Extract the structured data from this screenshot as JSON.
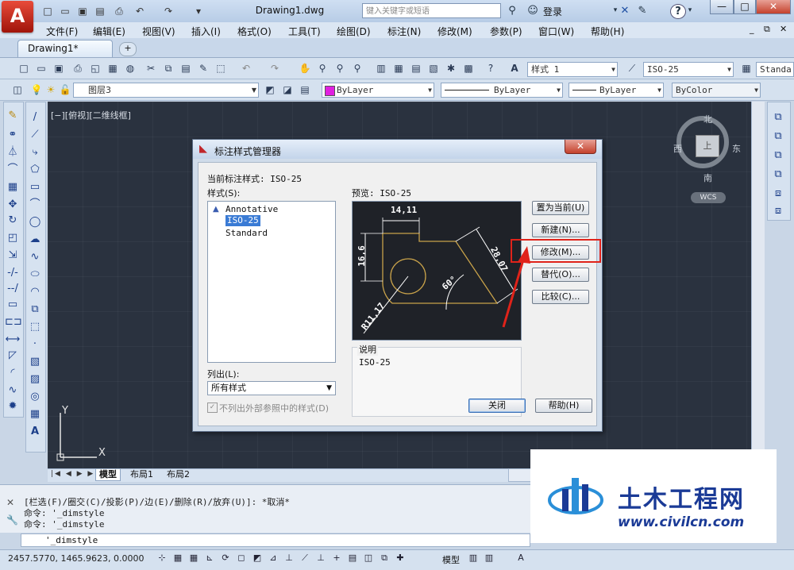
{
  "titlebar": {
    "doc_title": "Drawing1.dwg",
    "search_placeholder": "键入关键字或短语",
    "login_label": "登录",
    "help_label": "?"
  },
  "menubar": {
    "items": [
      "文件(F)",
      "编辑(E)",
      "视图(V)",
      "插入(I)",
      "格式(O)",
      "工具(T)",
      "绘图(D)",
      "标注(N)",
      "修改(M)",
      "参数(P)",
      "窗口(W)",
      "帮助(H)"
    ]
  },
  "tabs": {
    "active_label": "Drawing1*"
  },
  "toolbars": {
    "text_style": "样式 1",
    "dim_style": "ISO-25",
    "table_style": "Standa",
    "layer": "图层3",
    "color": "ByLayer",
    "linetype": "ByLayer",
    "lineweight": "ByLayer",
    "plotstyle": "ByColor"
  },
  "viewport": {
    "label": "[−][俯视][二维线框]",
    "compass_north": "北",
    "compass_south": "南",
    "compass_east": "东",
    "compass_west": "西",
    "compass_center": "上",
    "wcs_label": "WCS",
    "ucs_x": "X",
    "ucs_y": "Y"
  },
  "layout_tabs": [
    "模型",
    "布局1",
    "布局2"
  ],
  "command": {
    "lines": [
      "[栏选(F)/圈交(C)/投影(P)/边(E)/删除(R)/放弃(U)]: *取消*",
      "命令: '_dimstyle",
      "命令: '_dimstyle"
    ],
    "input": "'_dimstyle"
  },
  "statusbar": {
    "coords": "2457.5770, 1465.9623, 0.0000",
    "model_label": "模型"
  },
  "dialog": {
    "title": "标注样式管理器",
    "current_style_label": "当前标注样式: ISO-25",
    "styles_label": "样式(S):",
    "styles": [
      "Annotative",
      "ISO-25",
      "Standard"
    ],
    "selected_style": "ISO-25",
    "preview_label": "预览: ISO-25",
    "list_label": "列出(L):",
    "list_value": "所有样式",
    "xref_checkbox_label": "不列出外部参照中的样式(D)",
    "description_label": "说明",
    "description_value": "ISO-25",
    "buttons": {
      "set_current": "置为当前(U)",
      "new": "新建(N)...",
      "modify": "修改(M)...",
      "override": "替代(O)...",
      "compare": "比较(C)...",
      "close": "关闭",
      "help": "帮助(H)"
    },
    "preview_dims": {
      "width": "14,11",
      "height": "16,6",
      "aligned": "28,07",
      "angle": "60°",
      "radius": "R11,17"
    }
  },
  "watermark": {
    "name": "土木工程网",
    "url": "www.civilcn.com"
  },
  "colors": {
    "highlight": "#e0231a",
    "preview_geometry": "#c8a24a",
    "preview_dims": "#ffffff",
    "canvas_bg": "#2a323f",
    "watermark_blue": "#1a3a96"
  }
}
